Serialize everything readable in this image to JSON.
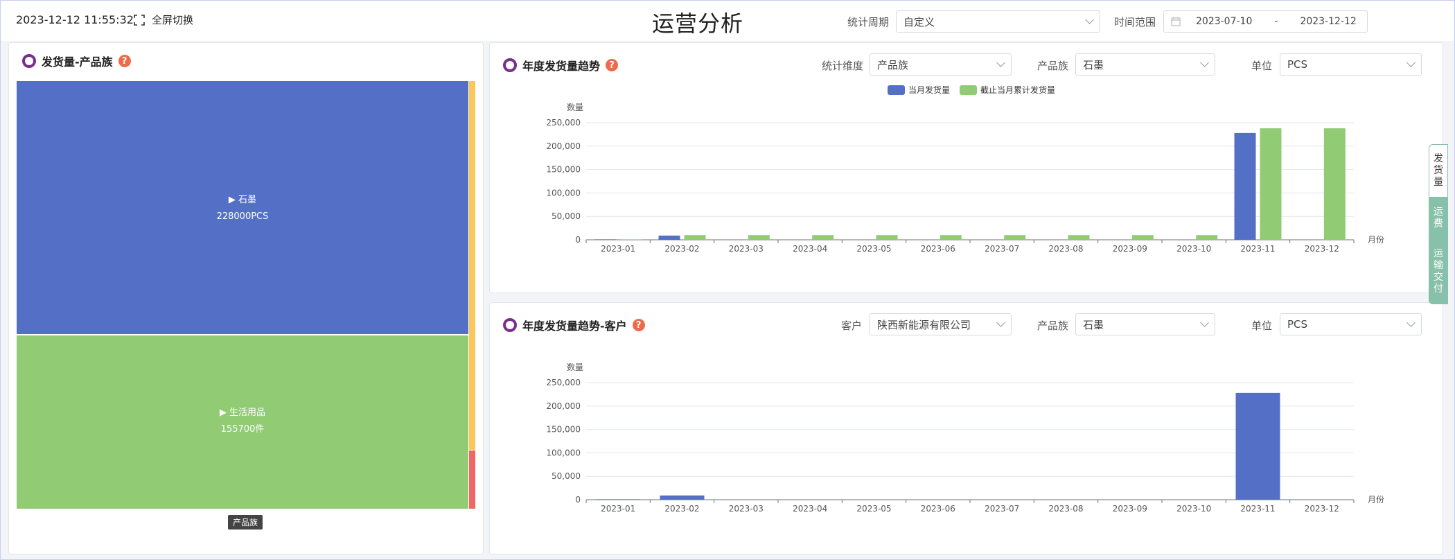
{
  "header": {
    "datetime": "2023-12-12 11:55:32",
    "fullscreen_label": "全屏切换",
    "title": "运营分析",
    "period_label": "统计周期",
    "period_value": "自定义",
    "range_label": "时间范围",
    "range_start": "2023-07-10",
    "range_sep": "-",
    "range_end": "2023-12-12"
  },
  "left_panel": {
    "title": "发货量-产品族",
    "help": "?",
    "footer_tag": "产品族",
    "blocks": [
      {
        "label": "▶ 石墨",
        "value": "228000PCS",
        "color": "#5470c6"
      },
      {
        "label": "▶ 生活用品",
        "value": "155700件",
        "color": "#91cc75"
      }
    ]
  },
  "trend_panel": {
    "title": "年度发货量趋势",
    "help": "?",
    "dimension_label": "统计维度",
    "dimension_value": "产品族",
    "family_label": "产品族",
    "family_value": "石墨",
    "unit_label": "单位",
    "unit_value": "PCS"
  },
  "customer_panel": {
    "title": "年度发货量趋势-客户",
    "help": "?",
    "customer_label": "客户",
    "customer_value": "陕西新能源有限公司",
    "family_label": "产品族",
    "family_value": "石墨",
    "unit_label": "单位",
    "unit_value": "PCS"
  },
  "side_tabs": [
    "发货量",
    "运费",
    "运输交付"
  ],
  "chart_data": [
    {
      "type": "bar",
      "ylabel": "数量",
      "xlabel": "月份",
      "ylim": [
        0,
        250000
      ],
      "yticks": [
        0,
        50000,
        100000,
        150000,
        200000,
        250000
      ],
      "grid": true,
      "legend_position": "top-center",
      "categories": [
        "2023-01",
        "2023-02",
        "2023-03",
        "2023-04",
        "2023-05",
        "2023-06",
        "2023-07",
        "2023-08",
        "2023-09",
        "2023-10",
        "2023-11",
        "2023-12"
      ],
      "series": [
        {
          "name": "当月发货量",
          "color": "#5470c6",
          "values": [
            1000,
            9000,
            0,
            0,
            0,
            0,
            0,
            0,
            0,
            0,
            228000,
            0
          ]
        },
        {
          "name": "截止当月累计发货量",
          "color": "#91cc75",
          "values": [
            1000,
            10000,
            10000,
            10000,
            10000,
            10000,
            10000,
            10000,
            10000,
            10000,
            238000,
            238000
          ]
        }
      ]
    },
    {
      "type": "bar",
      "ylabel": "数量",
      "xlabel": "月份",
      "ylim": [
        0,
        250000
      ],
      "yticks": [
        0,
        50000,
        100000,
        150000,
        200000,
        250000
      ],
      "grid": true,
      "categories": [
        "2023-01",
        "2023-02",
        "2023-03",
        "2023-04",
        "2023-05",
        "2023-06",
        "2023-07",
        "2023-08",
        "2023-09",
        "2023-10",
        "2023-11",
        "2023-12"
      ],
      "series": [
        {
          "color": "#5470c6",
          "values": [
            1000,
            9000,
            0,
            0,
            0,
            0,
            0,
            0,
            0,
            0,
            228000,
            0
          ]
        }
      ]
    }
  ]
}
